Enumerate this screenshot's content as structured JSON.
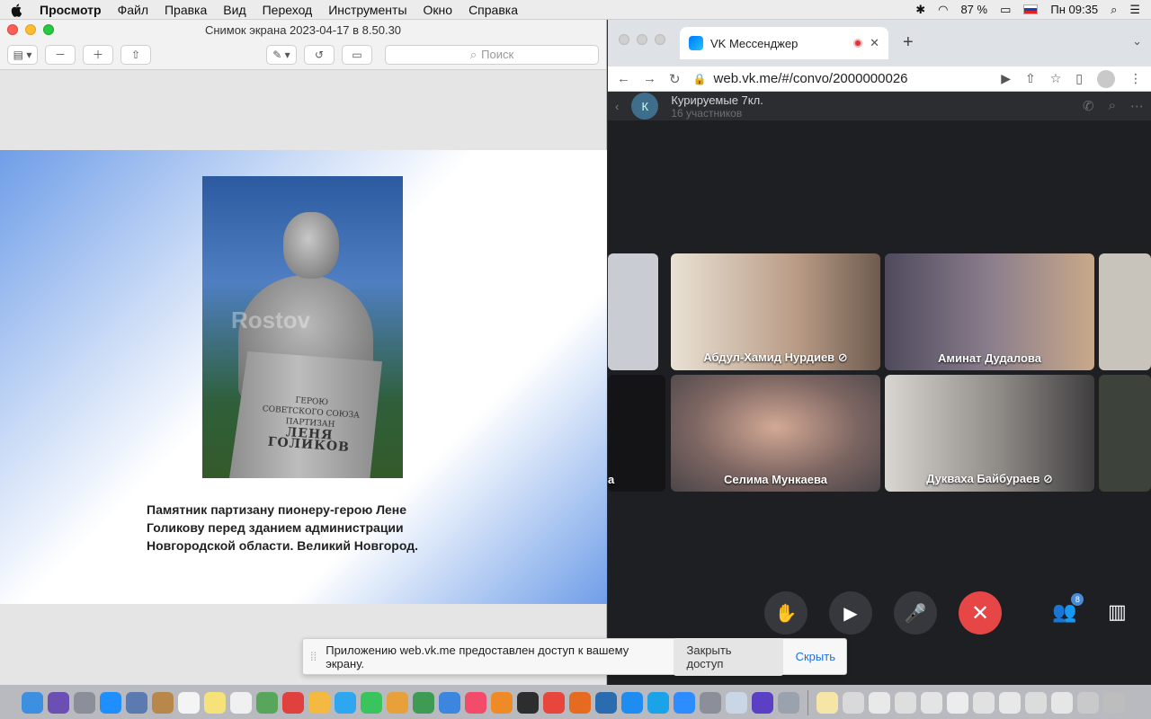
{
  "menubar": {
    "app": "Просмотр",
    "items": [
      "Файл",
      "Правка",
      "Вид",
      "Переход",
      "Инструменты",
      "Окно",
      "Справка"
    ],
    "battery": "87 %",
    "clock": "Пн 09:35"
  },
  "preview": {
    "title": "Снимок экрана 2023-04-17 в 8.50.30",
    "search_placeholder": "Поиск",
    "watermark": "Rostov",
    "plinth_line1": "ГЕРОЮ",
    "plinth_line2": "СОВЕТСКОГО СОЮЗА",
    "plinth_line3": "ПАРТИЗАН",
    "plinth_name": "ЛЕНЯ ГОЛИКОВ",
    "caption": "Памятник партизану пионеру-герою Лене Голикову перед зданием администрации Новгородской области. Великий Новгород."
  },
  "chrome": {
    "tab_title": "VK Мессенджер",
    "url": "web.vk.me/#/convo/2000000026"
  },
  "vk": {
    "avatar_letter": "К",
    "chat_title": "Курируемые 7кл.",
    "chat_subtitle": "16 участников",
    "participants": [
      {
        "name": "Абдул-Хамид Нурдиев",
        "muted": true
      },
      {
        "name": "Аминат Дудалова",
        "muted": false
      },
      {
        "name": "Селима Мункаева",
        "muted": false
      },
      {
        "name": "Дукваха Байбураев",
        "muted": true
      }
    ],
    "partial_tile_text": "а",
    "people_count": "8"
  },
  "share_notice": {
    "message": "Приложению web.vk.me предоставлен доступ к вашему экрану.",
    "stop_label": "Закрыть доступ",
    "hide_label": "Скрыть"
  },
  "colors": {
    "end_call": "#e64646",
    "vk_blue": "#0077ff"
  }
}
